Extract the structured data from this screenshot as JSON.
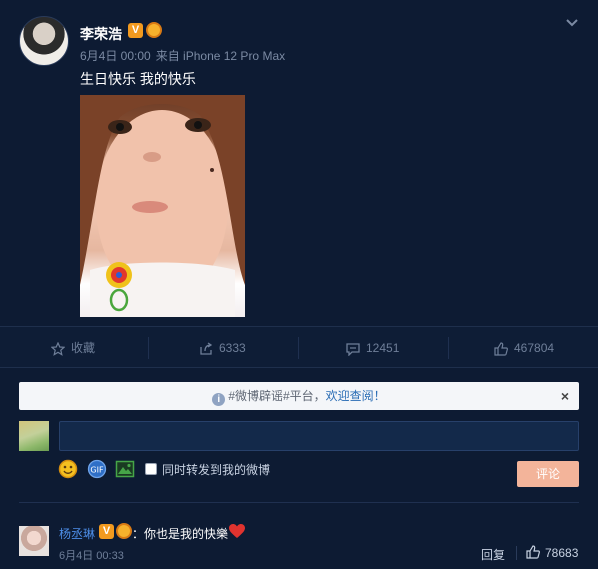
{
  "post": {
    "author": "李荣浩",
    "date": "6月4日 00:00",
    "source": "来自 iPhone 12 Pro Max",
    "text": "生日快乐 我的快乐"
  },
  "actions": {
    "favorite": "收藏",
    "repost_count": "6333",
    "comment_count": "12451",
    "like_count": "467804"
  },
  "notice": {
    "hashtag": "#微博辟谣#平台，",
    "link": "欢迎查阅！",
    "close": "×"
  },
  "composer": {
    "repost_label": "同时转发到我的微博",
    "submit": "评论"
  },
  "comment": {
    "name": "杨丞琳",
    "text": "：你也是我的快樂",
    "time": "6月4日 00:33",
    "reply": "回复",
    "likes": "78683"
  },
  "colors": {
    "background": "#0d1b33",
    "verified": "#f29a1f",
    "link": "#4d8ee8",
    "submit": "#f3b49a",
    "heart": "#e0332f"
  },
  "icons": [
    "chevron-down-icon",
    "star-icon",
    "share-icon",
    "comment-icon",
    "like-icon",
    "info-icon",
    "emoji-icon",
    "gif-icon",
    "image-icon",
    "heart-icon"
  ]
}
